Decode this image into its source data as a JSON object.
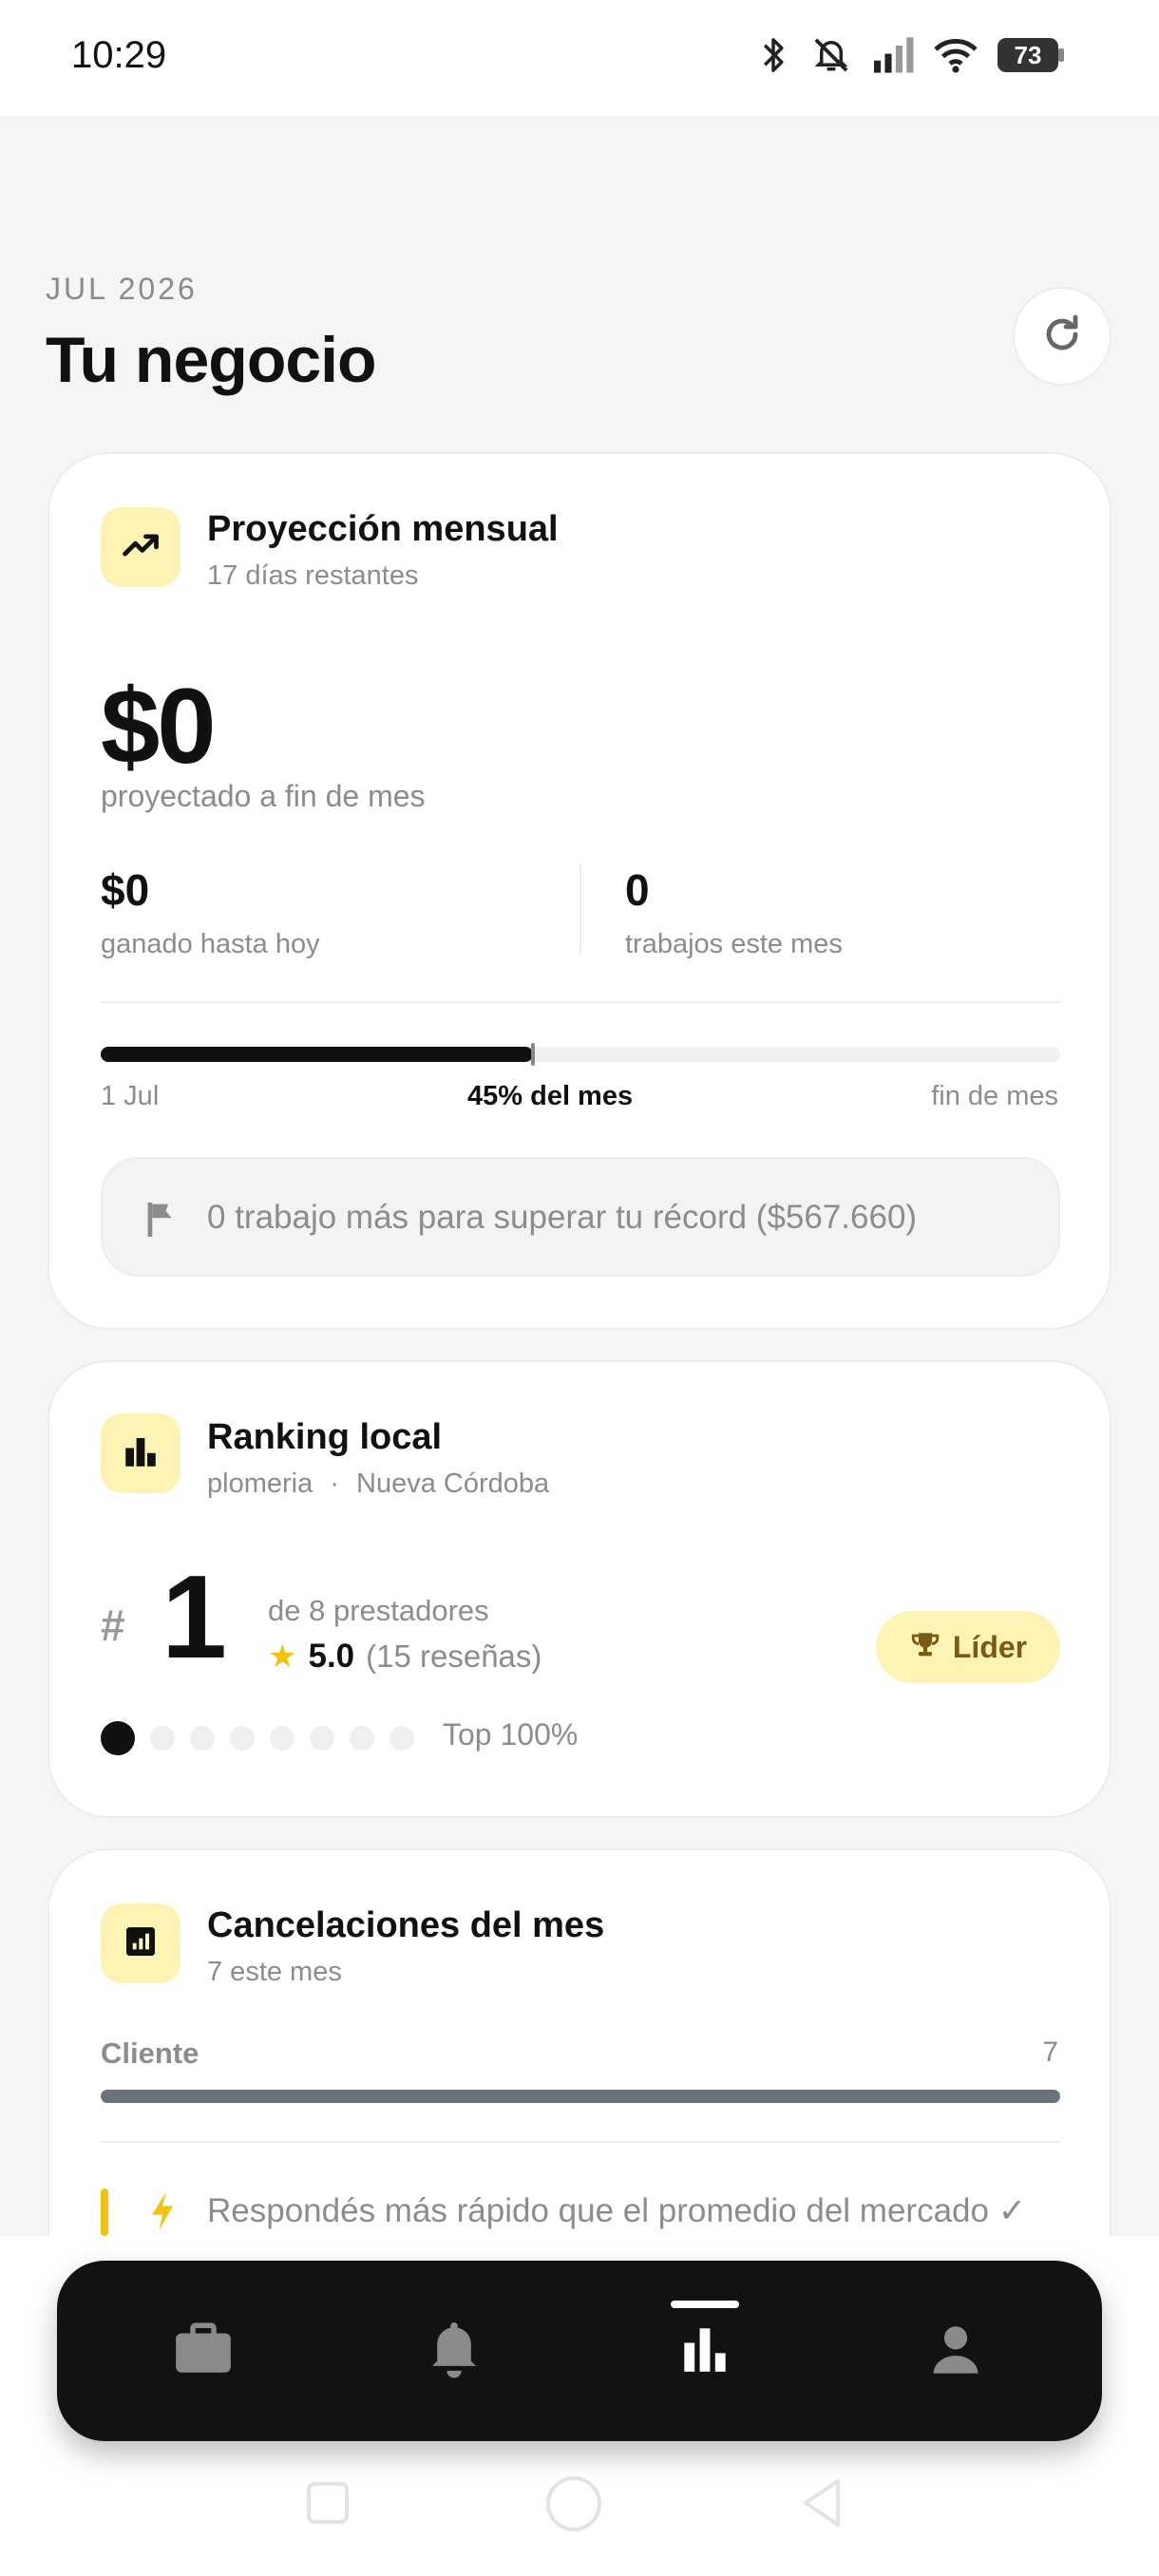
{
  "status_bar": {
    "time": "10:29",
    "battery": "73",
    "icons": [
      "bluetooth-icon",
      "notifications-off-icon",
      "cell-signal-icon",
      "wifi-icon",
      "battery-icon"
    ]
  },
  "header": {
    "month": "JUL 2026",
    "title": "Tu negocio",
    "refresh_icon": "refresh-icon"
  },
  "projection": {
    "title": "Proyección mensual",
    "subtitle": "17 días restantes",
    "amount": "$0",
    "amount_caption": "proyectado a fin de mes",
    "earned_value": "$0",
    "earned_caption": "ganado hasta hoy",
    "jobs_value": "0",
    "jobs_caption": "trabajos este mes",
    "progress_fraction": 0.45,
    "progress_start": "1 Jul",
    "progress_label": "45% del mes",
    "progress_end": "fin de mes",
    "record_text": "0 trabajo más para superar tu récord ($567.660)"
  },
  "ranking": {
    "title": "Ranking local",
    "category": "plomeria",
    "separator": "·",
    "location": "Nueva Córdoba",
    "hash": "#",
    "position": "1",
    "of_label": "de 8 prestadores",
    "rating": "5.0",
    "reviews": "(15 reseñas)",
    "badge": "Líder",
    "dots_total": 8,
    "dots_active": 1,
    "top_label": "Top 100%"
  },
  "cancellations": {
    "title": "Cancelaciones del mes",
    "subtitle": "7 este mes",
    "rows": [
      {
        "label": "Cliente",
        "value": "7"
      }
    ],
    "insight": "Respondés más rápido que el promedio del mercado ✓"
  },
  "bottom_nav": {
    "items": [
      {
        "icon": "briefcase-icon",
        "active": false
      },
      {
        "icon": "bell-icon",
        "active": false
      },
      {
        "icon": "bar-chart-icon",
        "active": true
      },
      {
        "icon": "person-icon",
        "active": false
      }
    ]
  },
  "colors": {
    "accent_yellow": "#f4c20d",
    "tile_yellow": "#fdf3b4",
    "dark": "#121212",
    "background": "#f5f5f3"
  }
}
